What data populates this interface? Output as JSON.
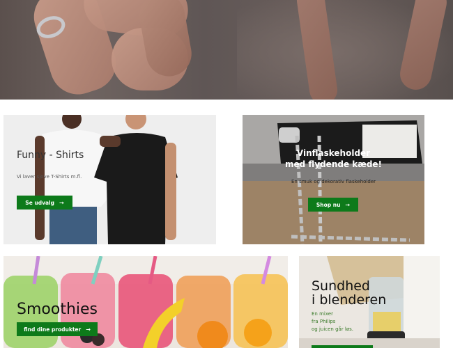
{
  "hero": {
    "alt": "hands-photo"
  },
  "cards": {
    "tshirts": {
      "title": "Funny - Shirts",
      "subtitle": "Vi laver sjove T-Shirts m.fl.",
      "button": "Se udvalg"
    },
    "wine": {
      "title_line1": "Vinflaskeholder",
      "title_line2": "med flydende kæde!",
      "subtitle": "En smuk og dekorativ flaskeholder",
      "button": "Shop nu"
    },
    "smoothies": {
      "title": "Smoothies",
      "button": "find dine produkter"
    },
    "blender": {
      "title_line1": "Sundhed",
      "title_line2": "i blenderen",
      "sub_line1": "En mixer",
      "sub_line2": "fra Philips",
      "sub_line3": "og juicen går løs."
    }
  },
  "colors": {
    "accent_green": "#0d7a1a"
  },
  "icons": {
    "button_arrow": "arrow-right-icon"
  }
}
